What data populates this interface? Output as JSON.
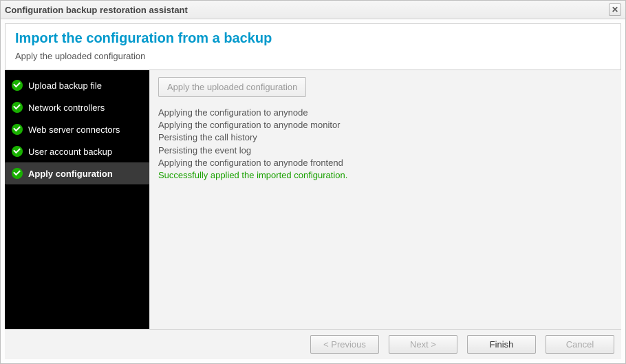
{
  "window": {
    "title": "Configuration backup restoration assistant"
  },
  "header": {
    "title": "Import the configuration from a backup",
    "subtitle": "Apply the uploaded configuration"
  },
  "sidebar": {
    "items": [
      {
        "label": "Upload backup file",
        "done": true,
        "active": false
      },
      {
        "label": "Network controllers",
        "done": true,
        "active": false
      },
      {
        "label": "Web server connectors",
        "done": true,
        "active": false
      },
      {
        "label": "User account backup",
        "done": true,
        "active": false
      },
      {
        "label": "Apply configuration",
        "done": true,
        "active": true
      }
    ]
  },
  "content": {
    "apply_button_label": "Apply the uploaded configuration",
    "log": [
      {
        "text": "Applying the configuration to anynode",
        "success": false
      },
      {
        "text": "Applying the configuration to anynode monitor",
        "success": false
      },
      {
        "text": "Persisting the call history",
        "success": false
      },
      {
        "text": "Persisting the event log",
        "success": false
      },
      {
        "text": "Applying the configuration to anynode frontend",
        "success": false
      },
      {
        "text": "Successfully applied the imported configuration.",
        "success": true
      }
    ]
  },
  "footer": {
    "previous": "< Previous",
    "next": "Next >",
    "finish": "Finish",
    "cancel": "Cancel"
  }
}
